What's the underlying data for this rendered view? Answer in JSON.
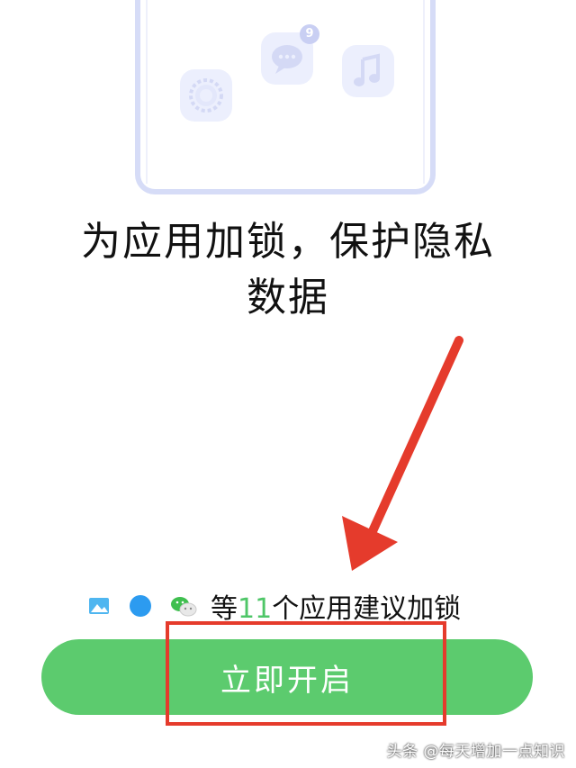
{
  "illustration": {
    "chat_badge_count": "9",
    "icons": [
      "settings-icon",
      "chat-icon",
      "music-icon"
    ]
  },
  "headline": {
    "line1": "为应用加锁，保护隐私",
    "line2": "数据"
  },
  "suggestion": {
    "icons": [
      "gallery-icon",
      "browser-icon",
      "wechat-icon"
    ],
    "prefix": "等",
    "count": "11",
    "suffix": "个应用建议加锁"
  },
  "cta": {
    "label": "立即开启"
  },
  "watermark": {
    "text": "头条 @每天增加一点知识"
  },
  "colors": {
    "accent_green": "#5ccb6e",
    "count_green": "#4fc668",
    "annotation_red": "#e53b2c",
    "illustration_lilac": "#d6dcf7"
  }
}
